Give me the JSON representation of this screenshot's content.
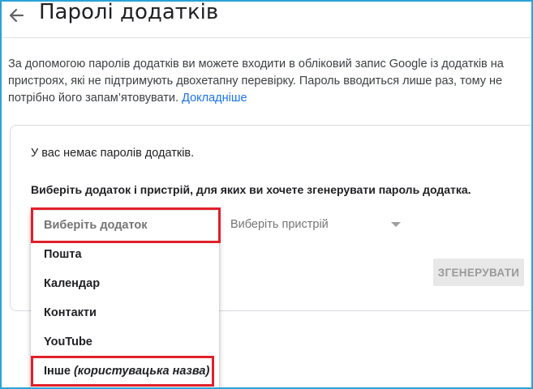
{
  "header": {
    "title": "Паролі додатків"
  },
  "intro": {
    "text": "За допомогою паролів додатків ви можете входити в обліковий запис Google із додатків на пристроях, які не підтримують двохетапну перевірку. Пароль вводиться лише раз, тому не потрібно його запам’ятовувати.",
    "link_label": "Докладніше"
  },
  "card": {
    "no_passwords_text": "У вас немає паролів додатків.",
    "prompt_text": "Виберіть додаток і пристрій, для яких ви хочете згенерувати пароль додатка.",
    "device_select_label": "Виберіть пристрій",
    "generate_button_label": "ЗГЕНЕРУВАТИ"
  },
  "app_dropdown": {
    "placeholder": "Виберіть додаток",
    "items": [
      "Пошта",
      "Календар",
      "Контакти",
      "YouTube"
    ],
    "other": {
      "label": "Інше",
      "suffix": "(користувацька назва)"
    }
  },
  "colors": {
    "link": "#1a73e8",
    "highlight_border": "#e0202a",
    "frame_border": "#29a3d6",
    "disabled_button_bg": "#e8e8e8"
  },
  "icons": {
    "back": "arrow-left-icon",
    "device_caret": "caret-down-icon"
  }
}
